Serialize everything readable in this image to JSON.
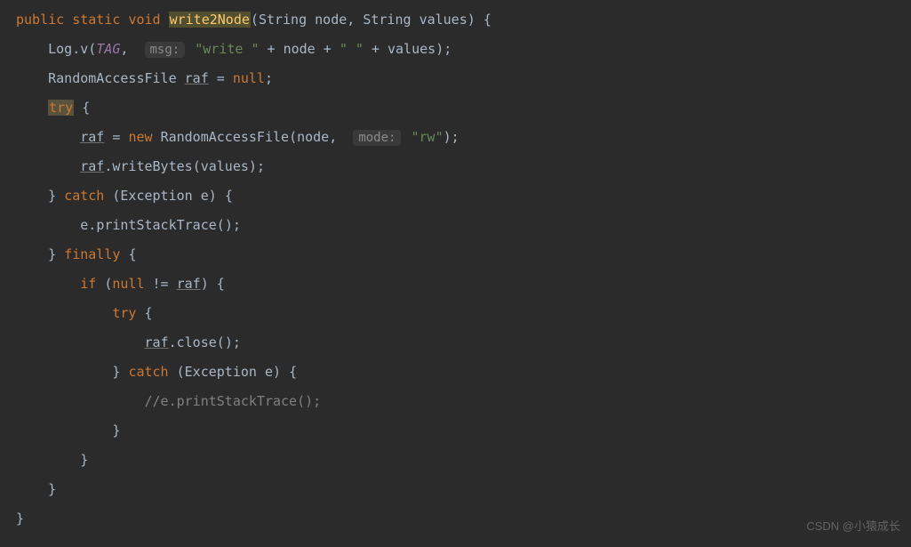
{
  "code": {
    "kw_public": "public",
    "kw_static": "static",
    "kw_void": "void",
    "method_name": "write2Node",
    "param1_type": "String",
    "param1_name": "node",
    "param2_type": "String",
    "param2_name": "values",
    "brace_open": "{",
    "brace_close": "}",
    "paren_open": "(",
    "paren_close": ")",
    "comma": ",",
    "semicolon": ";",
    "log_class": "Log",
    "dot": ".",
    "log_method": "v",
    "tag_ident": "TAG",
    "hint_msg": "msg:",
    "str_write": "\"write \"",
    "plus": "+",
    "str_space": "\" \"",
    "raf_type": "RandomAccessFile",
    "raf_var": "raf",
    "assign": "=",
    "kw_null": "null",
    "kw_try": "try",
    "kw_new": "new",
    "hint_mode": "mode:",
    "str_rw": "\"rw\"",
    "writeBytes": "writeBytes",
    "kw_catch": "catch",
    "exc_type": "Exception",
    "exc_var": "e",
    "printStackTrace": "printStackTrace",
    "kw_finally": "finally",
    "kw_if": "if",
    "neq": "!=",
    "close_method": "close",
    "comment_line": "//e.printStackTrace();"
  },
  "watermark": "CSDN @小猿成长"
}
